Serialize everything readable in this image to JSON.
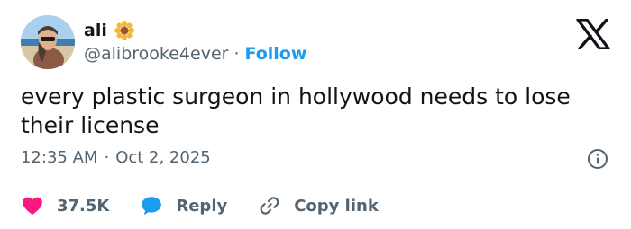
{
  "author": {
    "display_name": "ali",
    "handle": "@alibrooke4ever",
    "separator": "·",
    "follow_label": "Follow",
    "badge_icon": "sunflower-emoji",
    "avatar": "profile-photo"
  },
  "tweet": {
    "text": "every plastic surgeon in hollywood needs to lose their license",
    "time": "12:35 AM",
    "separator": "·",
    "date": "Oct 2, 2025"
  },
  "actions": {
    "like_count": "37.5K",
    "reply_label": "Reply",
    "copy_link_label": "Copy link"
  },
  "icons": {
    "logo": "x-logo-icon",
    "info": "info-icon",
    "like": "heart-icon",
    "reply": "speech-bubble-icon",
    "copy": "link-icon"
  },
  "colors": {
    "accent": "#1d9bf0",
    "like": "#f91880",
    "text_primary": "#0f1419",
    "text_secondary": "#536471",
    "divider": "#cfd9de"
  }
}
